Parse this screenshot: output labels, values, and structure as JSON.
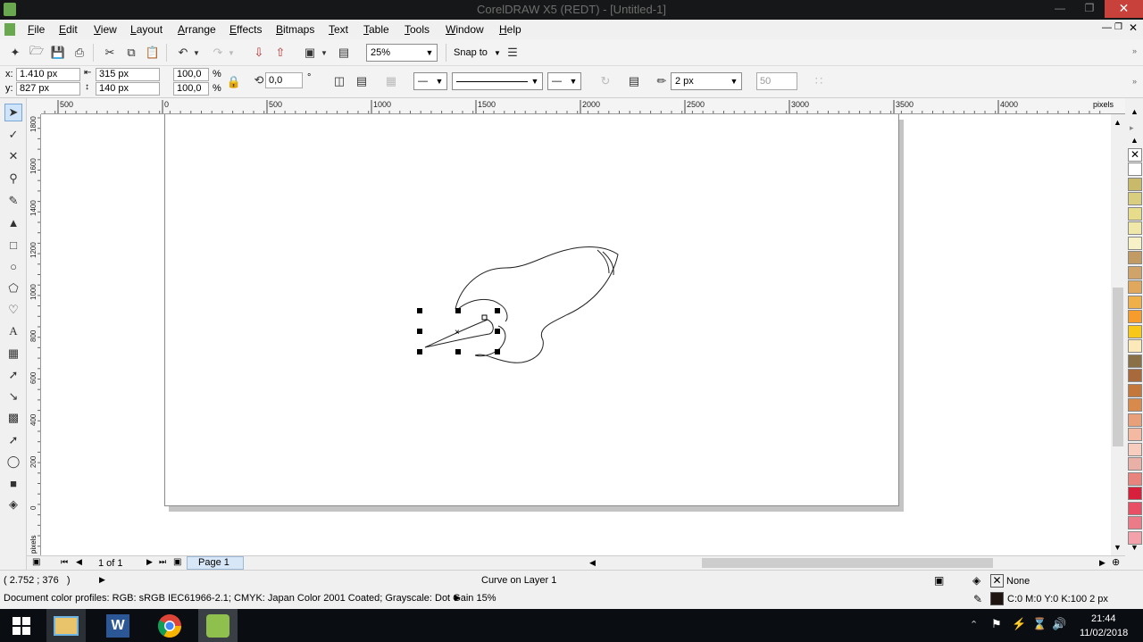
{
  "window": {
    "title": "CorelDRAW X5 (REDT) - [Untitled-1]"
  },
  "menu": [
    "File",
    "Edit",
    "View",
    "Layout",
    "Arrange",
    "Effects",
    "Bitmaps",
    "Text",
    "Table",
    "Tools",
    "Window",
    "Help"
  ],
  "toolbar": {
    "zoom": "25%",
    "snap_to": "Snap to"
  },
  "properties": {
    "x": "1.410 px",
    "y": "827 px",
    "width": "315 px",
    "height": "140 px",
    "scale_x": "100,0",
    "scale_y": "100,0",
    "percent": "%",
    "rotation": "0,0",
    "degree": "°",
    "outline_width": "2 px",
    "value_50": "50"
  },
  "rulers": {
    "h_ticks": [
      "500",
      "0",
      "500",
      "1000",
      "1500",
      "2000",
      "2500",
      "3000",
      "3500",
      "4000"
    ],
    "h_unit": "pixels",
    "v_ticks": [
      "1800",
      "1600",
      "1400",
      "1200",
      "1000",
      "800",
      "600",
      "400",
      "200",
      "0"
    ],
    "v_unit": "pixels"
  },
  "pages": {
    "counter": "1 of 1",
    "tab": "Page 1"
  },
  "status": {
    "coords": "( 2.752 ; 376   )",
    "object_info": "Curve on Layer 1",
    "color_profiles": "Document color profiles: RGB: sRGB IEC61966-2.1; CMYK: Japan Color 2001 Coated; Grayscale: Dot Gain 15%",
    "fill": "None",
    "outline": "C:0 M:0 Y:0 K:100  2 px"
  },
  "palette_colors": [
    "#ffffff",
    "#c9b96a",
    "#d9cd7f",
    "#e6dc8c",
    "#f0e8a8",
    "#f7f1c8",
    "#c29a64",
    "#cfa36a",
    "#e0a85c",
    "#f0b049",
    "#f59c2c",
    "#f7c71a",
    "#fbe9b9",
    "#8a7047",
    "#a86a3b",
    "#c4773a",
    "#d88a4c",
    "#e8a07a",
    "#f4b9a2",
    "#f7cdbf",
    "#e9b0a8",
    "#e8847e",
    "#d6203c",
    "#e84f64",
    "#ec7b8a",
    "#f3a2ab"
  ],
  "clock": {
    "time": "21:44",
    "date": "11/02/2018"
  }
}
